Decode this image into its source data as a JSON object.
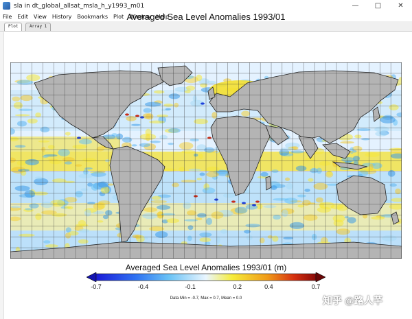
{
  "window": {
    "title": "sla in dt_global_allsat_msla_h_y1993_m01",
    "controls": {
      "minimize": "—",
      "maximize": "□",
      "close": "✕"
    }
  },
  "menu": [
    "File",
    "Edit",
    "View",
    "History",
    "Bookmarks",
    "Plot",
    "Window",
    "Help"
  ],
  "tabs": [
    "Plot",
    "Array 1"
  ],
  "plot": {
    "title": "Averaged Sea Level Anomalies 1993/01"
  },
  "colorbar": {
    "title": "Averaged Sea Level Anomalies 1993/01 (m)",
    "min": -0.7,
    "max": 0.7,
    "tick_labels": [
      "-0.7",
      "-0.4",
      "-0.1",
      "0.2",
      "0.4",
      "0.7"
    ],
    "tick_values": [
      -0.7,
      -0.4,
      -0.1,
      0.2,
      0.4,
      0.7
    ],
    "stats": "Data Min = -0.7, Max = 0.7, Mean = 0.0"
  },
  "watermark": "知乎 @路人芊",
  "colors": {
    "land": "#b4b4b4",
    "ocean_near_zero": "#e8f4ff",
    "positive": "#f4e030",
    "negative": "#46a8f0",
    "extreme_positive": "#c81800",
    "extreme_negative": "#1030d8"
  }
}
